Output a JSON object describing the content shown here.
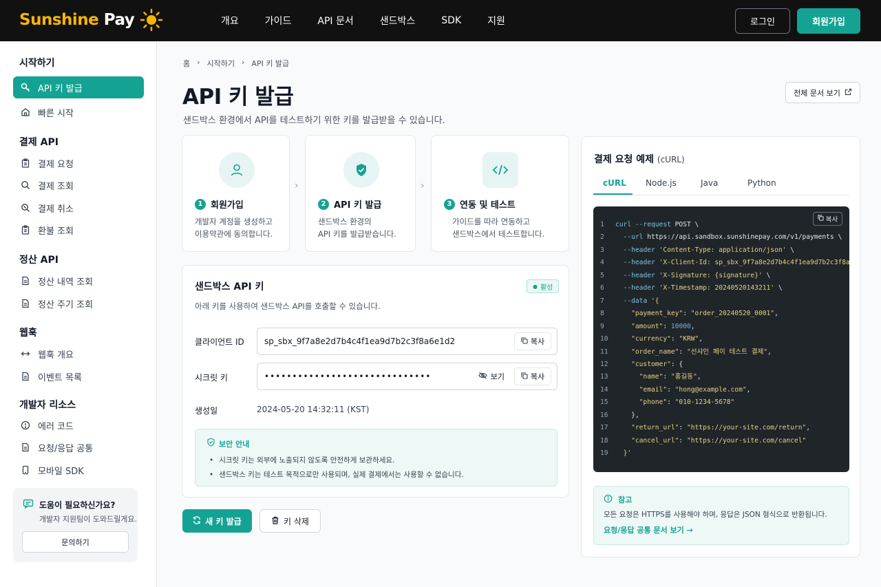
{
  "header": {
    "logo_main": "Sunshine",
    "logo_accent": "Pay",
    "nav": [
      "개요",
      "가이드",
      "API 문서",
      "샌드박스",
      "SDK",
      "지원"
    ],
    "login": "로그인",
    "signup": "회원가입"
  },
  "sidebar": {
    "sections": [
      {
        "title": "시작하기",
        "items": [
          {
            "label": "API 키 발급",
            "icon": "key-icon",
            "active": true
          },
          {
            "label": "빠른 시작",
            "icon": "home-icon"
          }
        ]
      },
      {
        "title": "결제 API",
        "items": [
          {
            "label": "결제 요청",
            "icon": "clipboard-icon"
          },
          {
            "label": "결제 조회",
            "icon": "search-icon"
          },
          {
            "label": "결제 취소",
            "icon": "cancel-search-icon"
          },
          {
            "label": "환불 조회",
            "icon": "receipt-icon"
          }
        ]
      },
      {
        "title": "정산 API",
        "items": [
          {
            "label": "정산 내역 조회",
            "icon": "document-icon"
          },
          {
            "label": "정산 주기 조회",
            "icon": "document-icon"
          }
        ]
      },
      {
        "title": "웹훅",
        "items": [
          {
            "label": "웹훅 개요",
            "icon": "arrows-icon"
          },
          {
            "label": "이벤트 목록",
            "icon": "document-icon"
          }
        ]
      },
      {
        "title": "개발자 리소스",
        "items": [
          {
            "label": "에러 코드",
            "icon": "info-icon"
          },
          {
            "label": "요청/응답 공통",
            "icon": "document-icon"
          },
          {
            "label": "모바일 SDK",
            "icon": "phone-icon"
          }
        ]
      }
    ],
    "help": {
      "title": "도움이 필요하신가요?",
      "subtitle": "개발자 지원팀이 도와드릴게요.",
      "button": "문의하기"
    }
  },
  "main": {
    "breadcrumb": [
      "홈",
      "시작하기",
      "API 키 발급"
    ],
    "title": "API 키 발급",
    "description": "샌드박스 환경에서 API를 테스트하기 위한 키를 발급받을 수 있습니다.",
    "doc_button": "전체 문서 보기",
    "steps": [
      {
        "num": "1",
        "title": "회원가입",
        "desc1": "개발자 계정을 생성하고",
        "desc2": "이용약관에 동의합니다.",
        "icon": "user-icon"
      },
      {
        "num": "2",
        "title": "API 키 발급",
        "desc1": "샌드박스 환경의",
        "desc2": "API 키를 발급받습니다.",
        "icon": "shield-check-icon"
      },
      {
        "num": "3",
        "title": "연동 및 테스트",
        "desc1": "가이드를 따라 연동하고",
        "desc2": "샌드박스에서 테스트합니다.",
        "icon": "code-icon"
      }
    ],
    "key_card": {
      "title": "샌드박스 API 키",
      "badge": "활성",
      "description": "아래 키를 사용하여 샌드박스 API를 호출할 수 있습니다.",
      "client_id_label": "클라이언트 ID",
      "client_id": "sp_sbx_9f7a8e2d7b4c4f1ea9d7b2c3f8a6e1d2",
      "secret_label": "시크릿 키",
      "secret": "••••••••••••••••••••••••••••••",
      "show": "보기",
      "copy": "복사",
      "created_label": "생성일",
      "created": "2024-05-20 14:32:11 (KST)",
      "notice_title": "보안 안내",
      "notice_items": [
        "시크릿 키는 외부에 노출되지 않도록 안전하게 보관하세요.",
        "샌드박스 키는 테스트 목적으로만 사용되며, 실제 결제에서는 사용할 수 없습니다."
      ]
    },
    "new_key": "새 키 발급",
    "delete_key": "키 삭제"
  },
  "code_panel": {
    "title": "결제 요청 예제",
    "title_suffix": "(cURL)",
    "tabs": [
      "cURL",
      "Node.js",
      "Java",
      "Python"
    ],
    "copy": "복사",
    "ref_title": "참고",
    "ref_desc": "모든 요청은 HTTPS를 사용해야 하며, 응답은 JSON 형식으로 반환됩니다.",
    "ref_link": "요청/응답 공통 문서 보기 →"
  },
  "colors": {
    "accent": "#14a393",
    "brand_yellow": "#f7b500",
    "header_bg": "#111111",
    "code_bg": "#1f2528"
  }
}
